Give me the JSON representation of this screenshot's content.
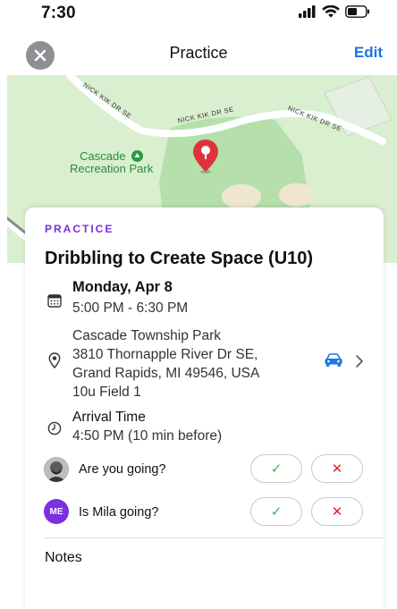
{
  "status_bar": {
    "time": "7:30"
  },
  "nav": {
    "title": "Practice",
    "edit_label": "Edit"
  },
  "map": {
    "street_labels": [
      "NICK KIK DR SE",
      "NICK KIK DR SE",
      "NICK KIK DR SE"
    ],
    "park_label_line1": "Cascade",
    "park_label_line2": "Recreation Park"
  },
  "event": {
    "kicker": "PRACTICE",
    "title": "Dribbling to Create Space (U10)",
    "date": "Monday, Apr 8",
    "time_range": "5:00 PM - 6:30 PM",
    "location": {
      "name": "Cascade Township Park",
      "address_line1": "3810 Thornapple River Dr SE,",
      "address_line2": "Grand Rapids, MI 49546, USA",
      "field": "10u Field 1"
    },
    "arrival": {
      "label": "Arrival Time",
      "value": "4:50 PM (10 min before)"
    }
  },
  "rsvp": [
    {
      "question": "Are you going?",
      "avatar_initials": "",
      "yes_symbol": "✓",
      "no_symbol": "✕"
    },
    {
      "question": "Is Mila going?",
      "avatar_initials": "ME",
      "yes_symbol": "✓",
      "no_symbol": "✕"
    }
  ],
  "notes": {
    "label": "Notes"
  },
  "colors": {
    "accent": "#7b2fe0",
    "link": "#1a76e0",
    "yes": "#3bb54a",
    "no": "#e0202a",
    "map_bg": "#d9efcf",
    "avatar_purple": "#7b2fe0"
  }
}
